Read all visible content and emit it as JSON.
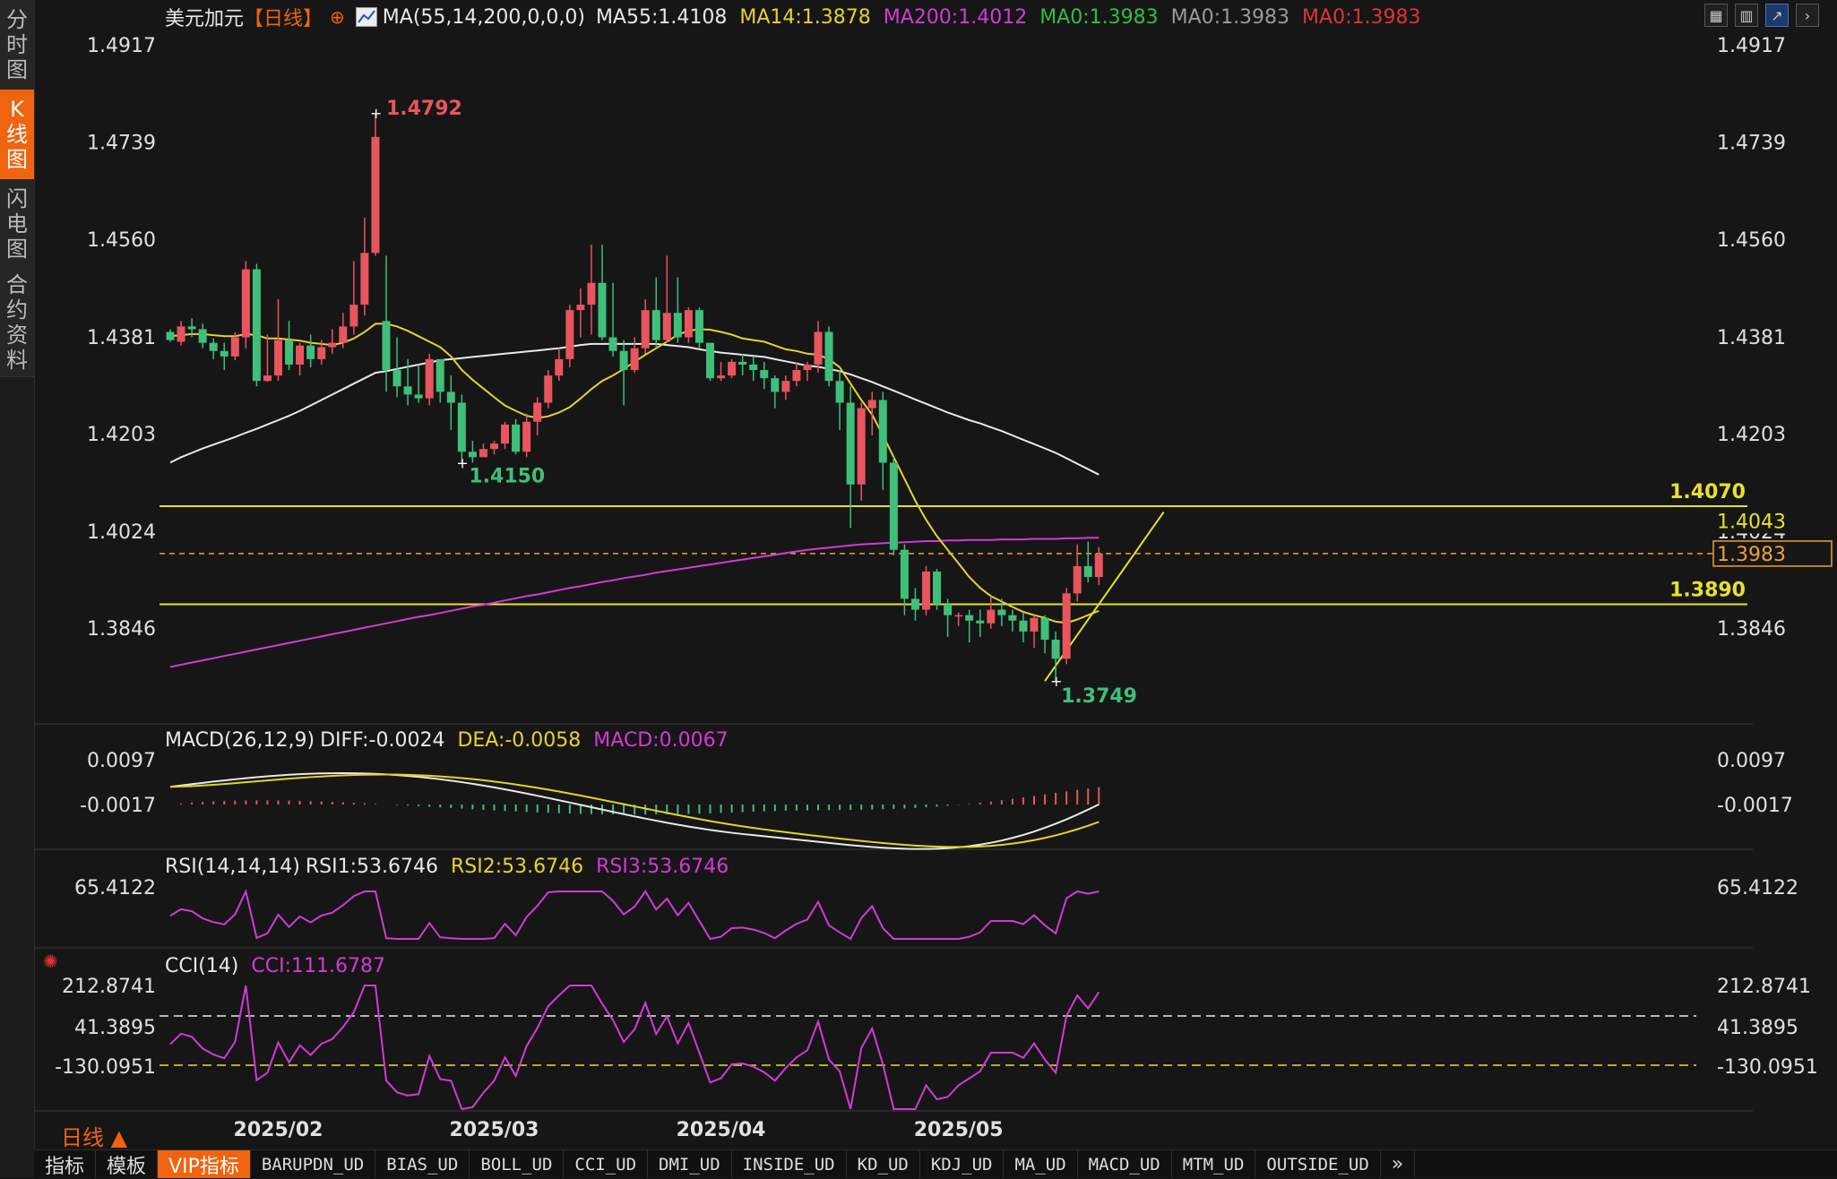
{
  "sidebar": {
    "tabs": [
      {
        "label": "分时图",
        "active": false
      },
      {
        "label": "K线图",
        "active": true
      },
      {
        "label": "闪电图",
        "active": false
      },
      {
        "label": "合约资料",
        "active": false
      }
    ]
  },
  "header": {
    "symbol": "美元加元",
    "period": "【日线】",
    "ma_params": "MA(55,14,200,0,0,0)",
    "ma_values": [
      {
        "text": "MA55:1.4108",
        "color": "#e8e8e8"
      },
      {
        "text": "MA14:1.3878",
        "color": "#e8d22a"
      },
      {
        "text": "MA200:1.4012",
        "color": "#d23ad6"
      },
      {
        "text": "MA0:1.3983",
        "color": "#2fbf3f"
      },
      {
        "text": "MA0:1.3983",
        "color": "#9a9a9a"
      },
      {
        "text": "MA0:1.3983",
        "color": "#e03434"
      }
    ]
  },
  "toolbar": {
    "icons": [
      "grid-icon",
      "bar-chart-icon",
      "trend-icon",
      "chevron-right-icon"
    ]
  },
  "price_axis": {
    "labels": [
      "1.4917",
      "1.4739",
      "1.4560",
      "1.4381",
      "1.4203",
      "1.4024",
      "1.3846"
    ],
    "values": [
      1.4917,
      1.4739,
      1.456,
      1.4381,
      1.4203,
      1.4024,
      1.3846
    ]
  },
  "annotations": {
    "high": "1.4792",
    "low_a": "1.4150",
    "low_b": "1.3749",
    "hline1": "1.4070",
    "hline2": "1.3890",
    "tag_ma200": "1.4043",
    "tag_last": "1.3983"
  },
  "macd": {
    "title": "MACD(26,12,9)",
    "diff": "DIFF:-0.0024",
    "dea": "DEA:-0.0058",
    "macd": "MACD:0.0067",
    "axis_labels": [
      "0.0097",
      "-0.0017"
    ]
  },
  "rsi": {
    "title": "RSI(14,14,14)",
    "rsi1": "RSI1:53.6746",
    "rsi2": "RSI2:53.6746",
    "rsi3": "RSI3:53.6746",
    "axis_labels": [
      "65.4122"
    ]
  },
  "cci": {
    "title": "CCI(14)",
    "cci": "CCI:111.6787",
    "axis_labels": [
      "212.8741",
      "41.3895",
      "-130.0951"
    ]
  },
  "time_axis": [
    "2025/02",
    "2025/03",
    "2025/04",
    "2025/05"
  ],
  "period_button": "日线 ▲",
  "bottom_tabs": [
    {
      "label": "指标",
      "mono": false,
      "active": false
    },
    {
      "label": "模板",
      "mono": false,
      "active": false
    },
    {
      "label": "VIP指标",
      "mono": false,
      "active": true
    },
    {
      "label": "BARUPDN_UD",
      "mono": true
    },
    {
      "label": "BIAS_UD",
      "mono": true
    },
    {
      "label": "BOLL_UD",
      "mono": true
    },
    {
      "label": "CCI_UD",
      "mono": true
    },
    {
      "label": "DMI_UD",
      "mono": true
    },
    {
      "label": "INSIDE_UD",
      "mono": true
    },
    {
      "label": "KD_UD",
      "mono": true
    },
    {
      "label": "KDJ_UD",
      "mono": true
    },
    {
      "label": "MA_UD",
      "mono": true
    },
    {
      "label": "MACD_UD",
      "mono": true
    },
    {
      "label": "MTM_UD",
      "mono": true
    },
    {
      "label": "OUTSIDE_UD",
      "mono": true
    },
    {
      "label": "»",
      "mono": false
    }
  ],
  "colors": {
    "up": "#e8555e",
    "down": "#3fbf7a",
    "ma55": "#e8e8e8",
    "ma14": "#e8d22a",
    "ma200": "#d23ad6",
    "hline": "#e8e02a",
    "last": "#f0a030"
  },
  "chart_data": {
    "type": "candlestick",
    "title": "美元加元【日线】",
    "ylim": [
      1.37,
      1.495
    ],
    "x": [
      "2025-01-20",
      "2025-01-21",
      "2025-01-22",
      "2025-01-23",
      "2025-01-24",
      "2025-01-27",
      "2025-01-28",
      "2025-01-29",
      "2025-01-30",
      "2025-01-31",
      "2025-02-03",
      "2025-02-04",
      "2025-02-05",
      "2025-02-06",
      "2025-02-07",
      "2025-02-10",
      "2025-02-11",
      "2025-02-12",
      "2025-02-13",
      "2025-02-14",
      "2025-02-17",
      "2025-02-18",
      "2025-02-19",
      "2025-02-20",
      "2025-02-21",
      "2025-02-24",
      "2025-02-25",
      "2025-02-26",
      "2025-02-27",
      "2025-02-28",
      "2025-03-03",
      "2025-03-04",
      "2025-03-05",
      "2025-03-06",
      "2025-03-07",
      "2025-03-10",
      "2025-03-11",
      "2025-03-12",
      "2025-03-13",
      "2025-03-14",
      "2025-03-17",
      "2025-03-18",
      "2025-03-19",
      "2025-03-20",
      "2025-03-21",
      "2025-03-24",
      "2025-03-25",
      "2025-03-26",
      "2025-03-27",
      "2025-03-28",
      "2025-03-31",
      "2025-04-01",
      "2025-04-02",
      "2025-04-03",
      "2025-04-04",
      "2025-04-07",
      "2025-04-08",
      "2025-04-09",
      "2025-04-10",
      "2025-04-11",
      "2025-04-14",
      "2025-04-15",
      "2025-04-16",
      "2025-04-17",
      "2025-04-18",
      "2025-04-21",
      "2025-04-22",
      "2025-04-23",
      "2025-04-24",
      "2025-04-25",
      "2025-04-28",
      "2025-04-29",
      "2025-04-30",
      "2025-05-01",
      "2025-05-02",
      "2025-05-05",
      "2025-05-06",
      "2025-05-07",
      "2025-05-08",
      "2025-05-09",
      "2025-05-12",
      "2025-05-13",
      "2025-05-14",
      "2025-05-15",
      "2025-05-16",
      "2025-05-19",
      "2025-05-20"
    ],
    "ohlc": [
      [
        1.439,
        1.4395,
        1.4375,
        1.4372
      ],
      [
        1.4372,
        1.441,
        1.44,
        1.4365
      ],
      [
        1.44,
        1.4415,
        1.4395,
        1.438
      ],
      [
        1.4395,
        1.4405,
        1.437,
        1.436
      ],
      [
        1.437,
        1.4378,
        1.4355,
        1.434
      ],
      [
        1.4355,
        1.437,
        1.4345,
        1.432
      ],
      [
        1.4345,
        1.439,
        1.438,
        1.4338
      ],
      [
        1.438,
        1.452,
        1.4505,
        1.436
      ],
      [
        1.4505,
        1.4515,
        1.43,
        1.429
      ],
      [
        1.43,
        1.4385,
        1.431,
        1.4298
      ],
      [
        1.431,
        1.445,
        1.4375,
        1.43
      ],
      [
        1.4375,
        1.441,
        1.433,
        1.432
      ],
      [
        1.433,
        1.437,
        1.4365,
        1.431
      ],
      [
        1.4365,
        1.4385,
        1.434,
        1.4325
      ],
      [
        1.434,
        1.4375,
        1.4362,
        1.433
      ],
      [
        1.4362,
        1.4395,
        1.437,
        1.435
      ],
      [
        1.437,
        1.4425,
        1.44,
        1.436
      ],
      [
        1.44,
        1.452,
        1.444,
        1.4385
      ],
      [
        1.444,
        1.46,
        1.4535,
        1.442
      ],
      [
        1.4535,
        1.4792,
        1.4748,
        1.453
      ],
      [
        1.441,
        1.453,
        1.432,
        1.428
      ],
      [
        1.432,
        1.438,
        1.429,
        1.427
      ],
      [
        1.429,
        1.434,
        1.4275,
        1.4255
      ],
      [
        1.4275,
        1.433,
        1.4268,
        1.426
      ],
      [
        1.4268,
        1.435,
        1.434,
        1.4255
      ],
      [
        1.434,
        1.432,
        1.428,
        1.426
      ],
      [
        1.428,
        1.431,
        1.426,
        1.421
      ],
      [
        1.426,
        1.4275,
        1.417,
        1.415
      ],
      [
        1.417,
        1.419,
        1.416,
        1.415
      ],
      [
        1.416,
        1.4185,
        1.4175,
        1.4162
      ],
      [
        1.4175,
        1.419,
        1.4185,
        1.4165
      ],
      [
        1.4185,
        1.4225,
        1.422,
        1.4175
      ],
      [
        1.422,
        1.423,
        1.417,
        1.4165
      ],
      [
        1.417,
        1.424,
        1.4225,
        1.416
      ],
      [
        1.4225,
        1.427,
        1.426,
        1.42
      ],
      [
        1.426,
        1.432,
        1.431,
        1.425
      ],
      [
        1.431,
        1.436,
        1.434,
        1.43
      ],
      [
        1.434,
        1.444,
        1.443,
        1.4325
      ],
      [
        1.443,
        1.447,
        1.444,
        1.438
      ],
      [
        1.444,
        1.455,
        1.448,
        1.4385
      ],
      [
        1.448,
        1.455,
        1.438,
        1.4375
      ],
      [
        1.438,
        1.448,
        1.4355,
        1.4345
      ],
      [
        1.4355,
        1.4375,
        1.432,
        1.4255
      ],
      [
        1.432,
        1.438,
        1.436,
        1.4315
      ],
      [
        1.436,
        1.445,
        1.443,
        1.435
      ],
      [
        1.443,
        1.449,
        1.4375,
        1.436
      ],
      [
        1.4375,
        1.453,
        1.4425,
        1.437
      ],
      [
        1.4425,
        1.449,
        1.438,
        1.437
      ],
      [
        1.438,
        1.4435,
        1.443,
        1.437
      ],
      [
        1.443,
        1.4435,
        1.437,
        1.436
      ],
      [
        1.437,
        1.437,
        1.4305,
        1.43
      ],
      [
        1.4305,
        1.4335,
        1.431,
        1.43
      ],
      [
        1.431,
        1.434,
        1.4335,
        1.4305
      ],
      [
        1.4335,
        1.435,
        1.433,
        1.431
      ],
      [
        1.433,
        1.4345,
        1.432,
        1.43
      ],
      [
        1.432,
        1.4335,
        1.4305,
        1.4285
      ],
      [
        1.4305,
        1.431,
        1.428,
        1.425
      ],
      [
        1.428,
        1.431,
        1.43,
        1.4265
      ],
      [
        1.43,
        1.4335,
        1.432,
        1.429
      ],
      [
        1.432,
        1.4335,
        1.433,
        1.43
      ],
      [
        1.433,
        1.441,
        1.439,
        1.4315
      ],
      [
        1.439,
        1.44,
        1.43,
        1.429
      ],
      [
        1.43,
        1.432,
        1.426,
        1.421
      ],
      [
        1.426,
        1.429,
        1.411,
        1.403
      ],
      [
        1.411,
        1.426,
        1.425,
        1.408
      ],
      [
        1.425,
        1.428,
        1.4265,
        1.42
      ],
      [
        1.4265,
        1.428,
        1.415,
        1.41
      ],
      [
        1.415,
        1.416,
        1.399,
        1.398
      ],
      [
        1.399,
        1.4,
        1.39,
        1.387
      ],
      [
        1.39,
        1.392,
        1.388,
        1.386
      ],
      [
        1.388,
        1.396,
        1.395,
        1.387
      ],
      [
        1.395,
        1.3955,
        1.389,
        1.388
      ],
      [
        1.389,
        1.39,
        1.387,
        1.383
      ],
      [
        1.387,
        1.3875,
        1.387,
        1.385
      ],
      [
        1.387,
        1.388,
        1.386,
        1.382
      ],
      [
        1.386,
        1.388,
        1.3855,
        1.383
      ],
      [
        1.3855,
        1.3905,
        1.388,
        1.3845
      ],
      [
        1.388,
        1.39,
        1.387,
        1.385
      ],
      [
        1.387,
        1.388,
        1.386,
        1.384
      ],
      [
        1.386,
        1.3875,
        1.384,
        1.382
      ],
      [
        1.384,
        1.387,
        1.3865,
        1.381
      ],
      [
        1.3865,
        1.387,
        1.3825,
        1.38
      ],
      [
        1.3825,
        1.384,
        1.379,
        1.3749
      ],
      [
        1.379,
        1.392,
        1.391,
        1.378
      ],
      [
        1.391,
        1.4,
        1.396,
        1.3895
      ],
      [
        1.396,
        1.4005,
        1.394,
        1.393
      ],
      [
        1.394,
        1.3995,
        1.3983,
        1.3925
      ]
    ],
    "ma55": [
      1.415,
      1.416,
      1.4168,
      1.4176,
      1.4183,
      1.419,
      1.4197,
      1.4205,
      1.4212,
      1.422,
      1.4228,
      1.4236,
      1.4245,
      1.4255,
      1.4265,
      1.4275,
      1.4285,
      1.4295,
      1.4305,
      1.4315,
      1.4318,
      1.4322,
      1.4326,
      1.433,
      1.4334,
      1.4338,
      1.434,
      1.4342,
      1.4344,
      1.4346,
      1.4348,
      1.435,
      1.4352,
      1.4354,
      1.4356,
      1.4358,
      1.436,
      1.4363,
      1.4366,
      1.4368,
      1.4368,
      1.4368,
      1.4368,
      1.4368,
      1.4368,
      1.4368,
      1.4366,
      1.4364,
      1.4362,
      1.4358,
      1.4355,
      1.4352,
      1.435,
      1.4348,
      1.4346,
      1.4344,
      1.434,
      1.4336,
      1.4332,
      1.4328,
      1.4326,
      1.4322,
      1.4318,
      1.4312,
      1.4305,
      1.4298,
      1.429,
      1.4282,
      1.4274,
      1.4266,
      1.4258,
      1.425,
      1.4242,
      1.4235,
      1.4228,
      1.4222,
      1.4215,
      1.4208,
      1.42,
      1.4192,
      1.4184,
      1.4176,
      1.4168,
      1.4158,
      1.4148,
      1.4138,
      1.4128
    ],
    "ma14": [
      1.4382,
      1.4384,
      1.4386,
      1.4386,
      1.4384,
      1.4382,
      1.4382,
      1.4386,
      1.4384,
      1.4378,
      1.4378,
      1.4376,
      1.4374,
      1.437,
      1.4368,
      1.4366,
      1.437,
      1.4378,
      1.439,
      1.4405,
      1.4405,
      1.44,
      1.4392,
      1.4382,
      1.4372,
      1.4362,
      1.4345,
      1.432,
      1.4302,
      1.4286,
      1.427,
      1.4255,
      1.4245,
      1.4236,
      1.4232,
      1.4235,
      1.4242,
      1.4252,
      1.4268,
      1.4285,
      1.43,
      1.431,
      1.4322,
      1.4335,
      1.4348,
      1.436,
      1.4372,
      1.4385,
      1.4392,
      1.4395,
      1.4394,
      1.439,
      1.4385,
      1.4378,
      1.4375,
      1.4372,
      1.4365,
      1.4358,
      1.4355,
      1.435,
      1.4348,
      1.434,
      1.4325,
      1.4295,
      1.4265,
      1.4238,
      1.42,
      1.416,
      1.412,
      1.408,
      1.4045,
      1.4015,
      1.399,
      1.3965,
      1.394,
      1.392,
      1.3905,
      1.3895,
      1.3885,
      1.3876,
      1.387,
      1.3865,
      1.3858,
      1.3856,
      1.3862,
      1.387,
      1.3878
    ],
    "ma200": [
      1.3775,
      1.3779,
      1.3783,
      1.3787,
      1.3791,
      1.3795,
      1.3799,
      1.3803,
      1.3807,
      1.3811,
      1.3815,
      1.3819,
      1.3823,
      1.3827,
      1.3831,
      1.3835,
      1.3839,
      1.3843,
      1.3847,
      1.3851,
      1.3855,
      1.3859,
      1.3863,
      1.3867,
      1.387,
      1.3874,
      1.3878,
      1.3882,
      1.3886,
      1.3889,
      1.3893,
      1.3897,
      1.3901,
      1.3905,
      1.3908,
      1.3912,
      1.3916,
      1.392,
      1.3923,
      1.3927,
      1.3931,
      1.3934,
      1.3938,
      1.3941,
      1.3944,
      1.3948,
      1.3951,
      1.3954,
      1.3957,
      1.396,
      1.3963,
      1.3966,
      1.3969,
      1.3972,
      1.3975,
      1.3978,
      1.3981,
      1.3984,
      1.3987,
      1.399,
      1.3992,
      1.3994,
      1.3996,
      1.3998,
      1.4,
      1.4001,
      1.4002,
      1.4003,
      1.4004,
      1.4005,
      1.4006,
      1.4006,
      1.4007,
      1.4007,
      1.4008,
      1.4008,
      1.4008,
      1.4009,
      1.4009,
      1.4009,
      1.401,
      1.401,
      1.401,
      1.4011,
      1.4011,
      1.4012,
      1.4012
    ],
    "hlines": [
      {
        "value": 1.407,
        "label": "1.4070"
      },
      {
        "value": 1.389,
        "label": "1.3890"
      }
    ],
    "last_price": 1.3983,
    "trendline": [
      {
        "x": "2025-05-13",
        "y": 1.3749
      },
      {
        "x": "2025-05-20",
        "y": 1.389
      }
    ]
  }
}
